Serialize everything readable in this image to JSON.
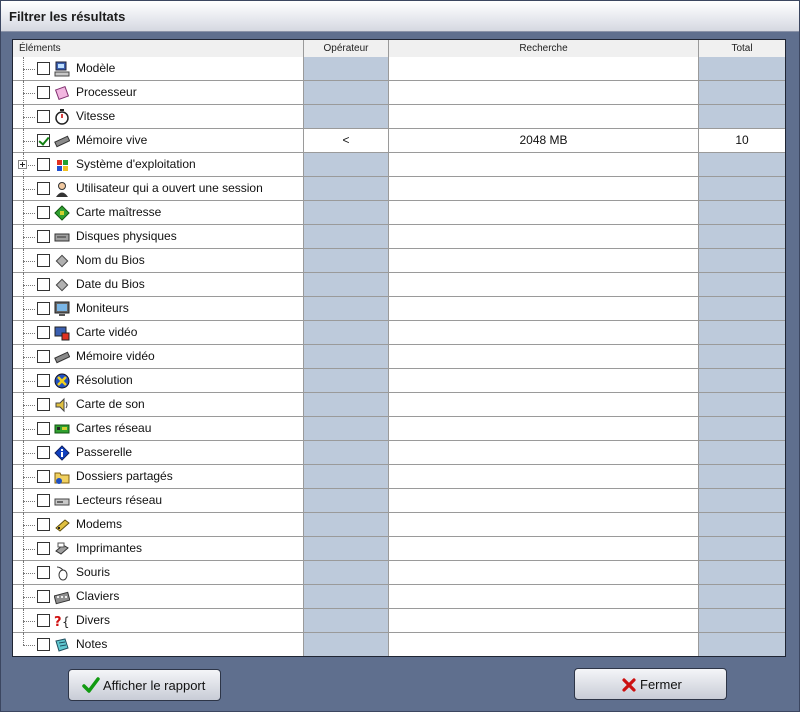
{
  "window": {
    "title": "Filtrer les résultats"
  },
  "columns": {
    "elements": "Éléments",
    "operator": "Opérateur",
    "search": "Recherche",
    "total": "Total"
  },
  "rows": [
    {
      "label": "Modèle",
      "icon": "computer-icon",
      "checked": false,
      "operator": "",
      "search": "",
      "total": ""
    },
    {
      "label": "Processeur",
      "icon": "processor-icon",
      "checked": false,
      "operator": "",
      "search": "",
      "total": ""
    },
    {
      "label": "Vitesse",
      "icon": "stopwatch-icon",
      "checked": false,
      "operator": "",
      "search": "",
      "total": ""
    },
    {
      "label": "Mémoire vive",
      "icon": "memory-chip-icon",
      "checked": true,
      "operator": "<",
      "search": "2048 MB",
      "total": "10"
    },
    {
      "label": "Système d'exploitation",
      "icon": "windows-flag-icon",
      "checked": false,
      "expandable": true,
      "operator": "",
      "search": "",
      "total": ""
    },
    {
      "label": "Utilisateur qui a ouvert une session",
      "icon": "user-icon",
      "checked": false,
      "operator": "",
      "search": "",
      "total": ""
    },
    {
      "label": "Carte maîtresse",
      "icon": "motherboard-icon",
      "checked": false,
      "operator": "",
      "search": "",
      "total": ""
    },
    {
      "label": "Disques physiques",
      "icon": "hard-disk-icon",
      "checked": false,
      "operator": "",
      "search": "",
      "total": ""
    },
    {
      "label": "Nom du Bios",
      "icon": "bios-chip-icon",
      "checked": false,
      "operator": "",
      "search": "",
      "total": ""
    },
    {
      "label": "Date du Bios",
      "icon": "bios-chip-icon",
      "checked": false,
      "operator": "",
      "search": "",
      "total": ""
    },
    {
      "label": "Moniteurs",
      "icon": "monitor-icon",
      "checked": false,
      "operator": "",
      "search": "",
      "total": ""
    },
    {
      "label": "Carte vidéo",
      "icon": "video-card-icon",
      "checked": false,
      "operator": "",
      "search": "",
      "total": ""
    },
    {
      "label": "Mémoire vidéo",
      "icon": "memory-chip-icon",
      "checked": false,
      "operator": "",
      "search": "",
      "total": ""
    },
    {
      "label": "Résolution",
      "icon": "resolution-icon",
      "checked": false,
      "operator": "",
      "search": "",
      "total": ""
    },
    {
      "label": "Carte de son",
      "icon": "speaker-icon",
      "checked": false,
      "operator": "",
      "search": "",
      "total": ""
    },
    {
      "label": "Cartes réseau",
      "icon": "network-card-icon",
      "checked": false,
      "operator": "",
      "search": "",
      "total": ""
    },
    {
      "label": "Passerelle",
      "icon": "info-icon",
      "checked": false,
      "operator": "",
      "search": "",
      "total": ""
    },
    {
      "label": "Dossiers partagés",
      "icon": "shared-folder-icon",
      "checked": false,
      "operator": "",
      "search": "",
      "total": ""
    },
    {
      "label": "Lecteurs réseau",
      "icon": "network-drive-icon",
      "checked": false,
      "operator": "",
      "search": "",
      "total": ""
    },
    {
      "label": "Modems",
      "icon": "modem-icon",
      "checked": false,
      "operator": "",
      "search": "",
      "total": ""
    },
    {
      "label": "Imprimantes",
      "icon": "printer-icon",
      "checked": false,
      "operator": "",
      "search": "",
      "total": ""
    },
    {
      "label": "Souris",
      "icon": "mouse-icon",
      "checked": false,
      "operator": "",
      "search": "",
      "total": ""
    },
    {
      "label": "Claviers",
      "icon": "keyboard-icon",
      "checked": false,
      "operator": "",
      "search": "",
      "total": ""
    },
    {
      "label": "Divers",
      "icon": "misc-icon",
      "checked": false,
      "operator": "",
      "search": "",
      "total": ""
    },
    {
      "label": "Notes",
      "icon": "note-icon",
      "checked": false,
      "operator": "",
      "search": "",
      "total": ""
    }
  ],
  "buttons": {
    "report": {
      "label": "Afficher le rapport",
      "icon": "checkmark-icon"
    },
    "close": {
      "label": "Fermer",
      "icon": "red-x-icon"
    }
  },
  "colors": {
    "background": "#5f6f8e",
    "disabled_cell": "#bdcadb",
    "check_green": "#108010",
    "close_red": "#cc1010"
  }
}
